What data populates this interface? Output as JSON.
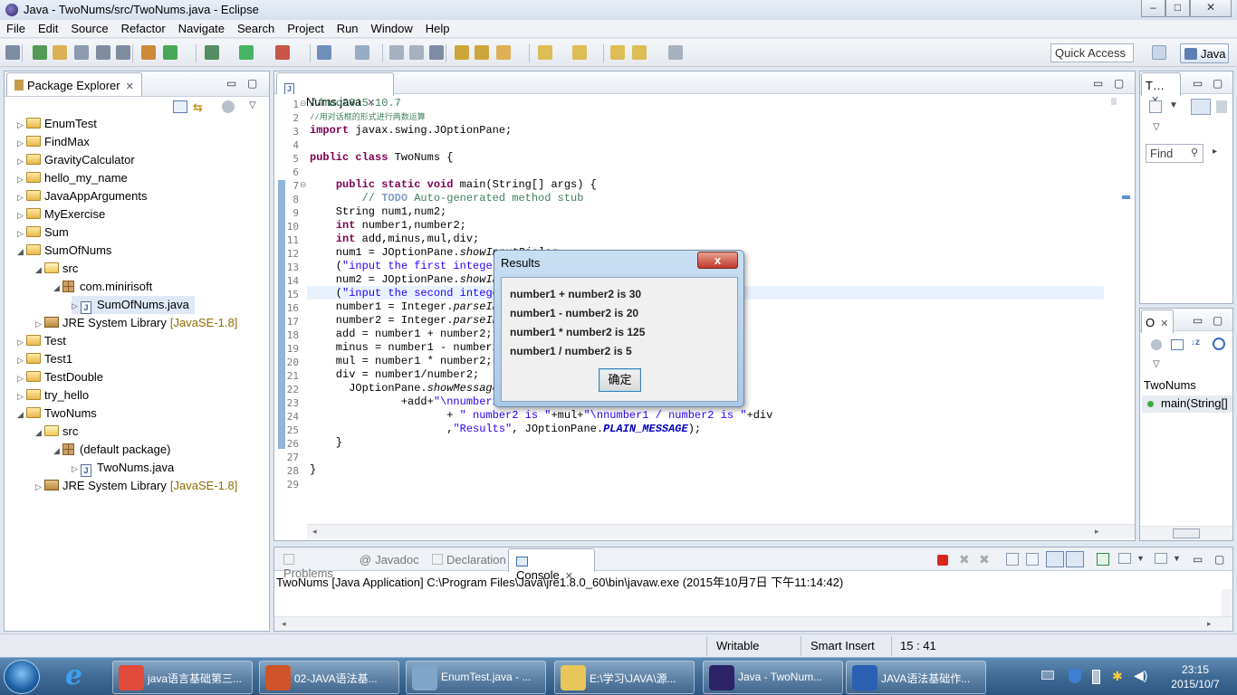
{
  "window": {
    "title": "Java - TwoNums/src/TwoNums.java - Eclipse",
    "min": "–",
    "max": "□",
    "close": "✕"
  },
  "menu": [
    "File",
    "Edit",
    "Source",
    "Refactor",
    "Navigate",
    "Search",
    "Project",
    "Run",
    "Window",
    "Help"
  ],
  "toolbar": {
    "quick_access": "Quick Access",
    "perspective": "Java"
  },
  "package_explorer": {
    "title": "Package Explorer",
    "rows": [
      {
        "arrow": "▷",
        "icon": "folder",
        "label": "EnumTest"
      },
      {
        "arrow": "▷",
        "icon": "folder",
        "label": "FindMax"
      },
      {
        "arrow": "▷",
        "icon": "folder",
        "label": "GravityCalculator"
      },
      {
        "arrow": "▷",
        "icon": "folder",
        "label": "hello_my_name"
      },
      {
        "arrow": "▷",
        "icon": "folder",
        "label": "JavaAppArguments"
      },
      {
        "arrow": "▷",
        "icon": "folder",
        "label": "MyExercise"
      },
      {
        "arrow": "▷",
        "icon": "folder",
        "label": "Sum"
      },
      {
        "arrow": "◢",
        "icon": "folder",
        "label": "SumOfNums"
      },
      {
        "arrow": "◢",
        "icon": "folder",
        "label": "src"
      },
      {
        "arrow": "◢",
        "icon": "pkg",
        "label": "com.minirisoft"
      },
      {
        "arrow": "▷",
        "icon": "jfile",
        "label": "SumOfNums.java"
      },
      {
        "arrow": "▷",
        "icon": "jar",
        "label": "JRE System Library",
        "suffix": "[JavaSE-1.8]"
      },
      {
        "arrow": "▷",
        "icon": "folder",
        "label": "Test"
      },
      {
        "arrow": "▷",
        "icon": "folder",
        "label": "Test1"
      },
      {
        "arrow": "▷",
        "icon": "folder",
        "label": "TestDouble"
      },
      {
        "arrow": "▷",
        "icon": "folder",
        "label": "try_hello"
      },
      {
        "arrow": "◢",
        "icon": "folder",
        "label": "TwoNums"
      },
      {
        "arrow": "◢",
        "icon": "folder",
        "label": "src"
      },
      {
        "arrow": "◢",
        "icon": "pkg",
        "label": "(default package)"
      },
      {
        "arrow": "▷",
        "icon": "jfile",
        "label": "TwoNums.java"
      },
      {
        "arrow": "▷",
        "icon": "jar",
        "label": "JRE System Library",
        "suffix": "[JavaSE-1.8]"
      }
    ]
  },
  "editor": {
    "tab": "TwoNums.java",
    "lines": [
      {
        "n": "1",
        "html": "<span class=\"cm\">//mao2015.10.7</span>"
      },
      {
        "n": "2",
        "html": "<span class=\"cm\" style=\"font-size:9px\">//用对话框的形式进行两数运算</span>"
      },
      {
        "n": "3",
        "html": "<span class=\"kw\">import</span> javax.swing.JOptionPane;"
      },
      {
        "n": "4",
        "html": ""
      },
      {
        "n": "5",
        "html": "<span class=\"kw\">public class</span> TwoNums {"
      },
      {
        "n": "6",
        "html": ""
      },
      {
        "n": "7",
        "html": "    <span class=\"kw\">public static void</span> main(String[] args) {"
      },
      {
        "n": "8",
        "html": "        <span class=\"cm\">// <span class=\"todo\">TODO</span> Auto-generated method stub</span>"
      },
      {
        "n": "9",
        "html": "    String num1,num2;"
      },
      {
        "n": "10",
        "html": "    <span class=\"kw\">int</span> number1,number2;"
      },
      {
        "n": "11",
        "html": "    <span class=\"kw\">int</span> add,minus,mul,div;"
      },
      {
        "n": "12",
        "html": "    num1 = JOptionPane.<span class=\"it\">showInputDialog</span>"
      },
      {
        "n": "13",
        "html": "    (<span class=\"st\">\"input the first integer\"</span>);"
      },
      {
        "n": "14",
        "html": "    num2 = JOptionPane.<span class=\"it\">showInputDialog</span>"
      },
      {
        "n": "15",
        "html": "    (<span class=\"st\">\"input the second integer\"</span>);"
      },
      {
        "n": "16",
        "html": "    number1 = Integer.<span class=\"it\">parseInt</span>(num1);"
      },
      {
        "n": "17",
        "html": "    number2 = Integer.<span class=\"it\">parseInt</span>(num2);"
      },
      {
        "n": "18",
        "html": "    add = number1 + number2;"
      },
      {
        "n": "19",
        "html": "    minus = number1 - number2;"
      },
      {
        "n": "20",
        "html": "    mul = number1 * number2;"
      },
      {
        "n": "21",
        "html": "    div = number1/number2;"
      },
      {
        "n": "22",
        "html": "      JOptionPane.<span class=\"it\">showMessageDialog</span>(<span class=\"kw\">null</span>,"
      },
      {
        "n": "23",
        "html": "              +add+<span class=\"st\">\"\\nnumber1 - number2 is \"</span>+minus"
      },
      {
        "n": "24",
        "html": "                     + <span class=\"st\">\" number2 is \"</span>+mul+<span class=\"st\">\"\\nnumber1 / number2 is \"</span>+div"
      },
      {
        "n": "25",
        "html": "                     ,<span class=\"st\">\"Results\"</span>, JOptionPane.<span class=\"sf\">PLAIN_MESSAGE</span>);"
      },
      {
        "n": "26",
        "html": "    }"
      },
      {
        "n": "27",
        "html": ""
      },
      {
        "n": "28",
        "html": "}"
      },
      {
        "n": "29",
        "html": ""
      }
    ]
  },
  "outline_top": {
    "title": "T…",
    "find": "Find"
  },
  "outline": {
    "title": "O",
    "class": "TwoNums",
    "method": "main(String[]"
  },
  "console": {
    "tabs": [
      "Problems",
      "Javadoc",
      "Declaration",
      "Console"
    ],
    "output": "TwoNums [Java Application] C:\\Program Files\\Java\\jre1.8.0_60\\bin\\javaw.exe (2015年10月7日 下午11:14:42)"
  },
  "dialog": {
    "title": "Results",
    "lines": [
      "number1 + number2 is 30",
      "number1 - number2 is 20",
      "number1 * number2 is 125",
      "number1 / number2 is 5"
    ],
    "ok": "确定",
    "close": "x"
  },
  "status": {
    "writable": "Writable",
    "insert": "Smart Insert",
    "position": "15 : 41"
  },
  "taskbar": {
    "items": [
      {
        "label": "java语言基础第三...",
        "icon": "chrome-icon",
        "color": "#e04a3a"
      },
      {
        "label": "02-JAVA语法基...",
        "icon": "powerpoint-icon",
        "color": "#d0542a"
      },
      {
        "label": "EnumTest.java - ...",
        "icon": "editor-icon",
        "color": "#7fa6c8"
      },
      {
        "label": "E:\\学习\\JAVA\\源...",
        "icon": "folder-icon",
        "color": "#e8c65a"
      },
      {
        "label": "Java - TwoNum...",
        "icon": "eclipse-icon",
        "color": "#2c2366"
      },
      {
        "label": "JAVA语法基础作...",
        "icon": "word-icon",
        "color": "#2b5fb3"
      }
    ],
    "time": "23:15",
    "date": "2015/10/7"
  }
}
